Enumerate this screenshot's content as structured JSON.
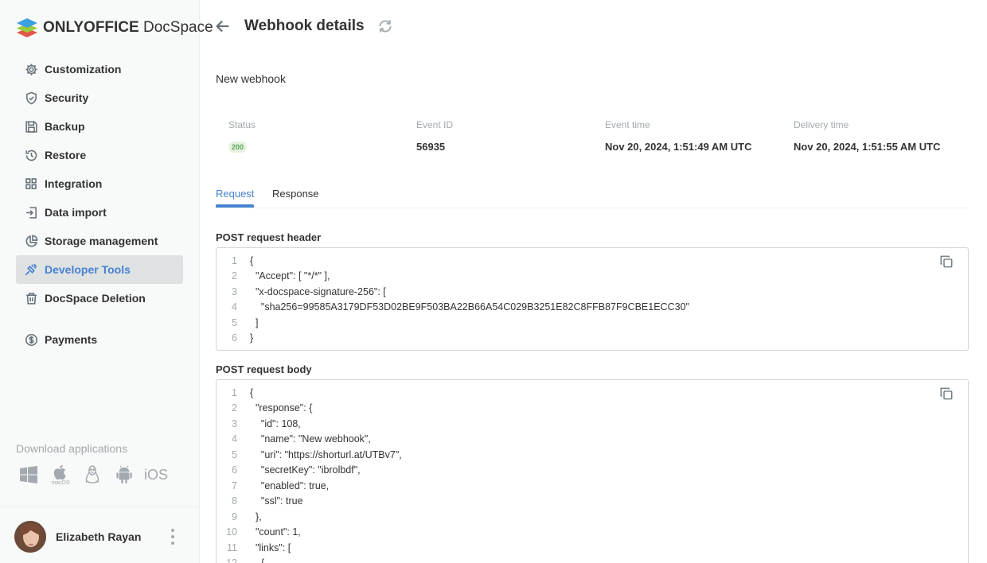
{
  "brand": {
    "name_bold": "ONLYOFFICE",
    "name_regular": "DocSpace"
  },
  "sidebar": {
    "items": [
      {
        "label": "Customization",
        "icon": "gear-icon",
        "active": false
      },
      {
        "label": "Security",
        "icon": "shield-icon",
        "active": false
      },
      {
        "label": "Backup",
        "icon": "floppy-icon",
        "active": false
      },
      {
        "label": "Restore",
        "icon": "restore-icon",
        "active": false
      },
      {
        "label": "Integration",
        "icon": "grid-icon",
        "active": false
      },
      {
        "label": "Data import",
        "icon": "import-icon",
        "active": false
      },
      {
        "label": "Storage management",
        "icon": "pie-chart-icon",
        "active": false
      },
      {
        "label": "Developer Tools",
        "icon": "developer-tools-icon",
        "active": true
      },
      {
        "label": "DocSpace Deletion",
        "icon": "trash-icon",
        "active": false
      }
    ],
    "payments": {
      "label": "Payments",
      "icon": "dollar-icon"
    },
    "download": {
      "title": "Download applications",
      "apps": [
        "windows-icon",
        "macos-icon",
        "linux-icon",
        "android-icon",
        "ios-icon"
      ],
      "macos_label": "macOS",
      "ios_label": "iOS"
    },
    "profile": {
      "name": "Elizabeth Rayan"
    }
  },
  "header": {
    "title": "Webhook details"
  },
  "webhook": {
    "name": "New webhook",
    "status_label": "Status",
    "status_code": "200",
    "event_id_label": "Event ID",
    "event_id": "56935",
    "event_time_label": "Event time",
    "event_time": "Nov 20, 2024, 1:51:49 AM UTC",
    "delivery_time_label": "Delivery time",
    "delivery_time": "Nov 20, 2024, 1:51:55 AM UTC"
  },
  "tabs": [
    {
      "label": "Request",
      "active": true
    },
    {
      "label": "Response",
      "active": false
    }
  ],
  "request_header": {
    "title": "POST request header",
    "lines": [
      "{",
      "  \"Accept\": [ \"*/*\" ],",
      "  \"x-docspace-signature-256\": [",
      "    \"sha256=99585A3179DF53D02BE9F503BA22B66A54C029B3251E82C8FFB87F9CBE1ECC30\"",
      "  ]",
      "}"
    ]
  },
  "request_body": {
    "title": "POST request body",
    "lines": [
      "{",
      "  \"response\": {",
      "    \"id\": 108,",
      "    \"name\": \"New webhook\",",
      "    \"uri\": \"https://shorturl.at/UTBv7\",",
      "    \"secretKey\": \"ibrolbdf\",",
      "    \"enabled\": true,",
      "    \"ssl\": true",
      "  },",
      "  \"count\": 1,",
      "  \"links\": [",
      "    {"
    ]
  }
}
